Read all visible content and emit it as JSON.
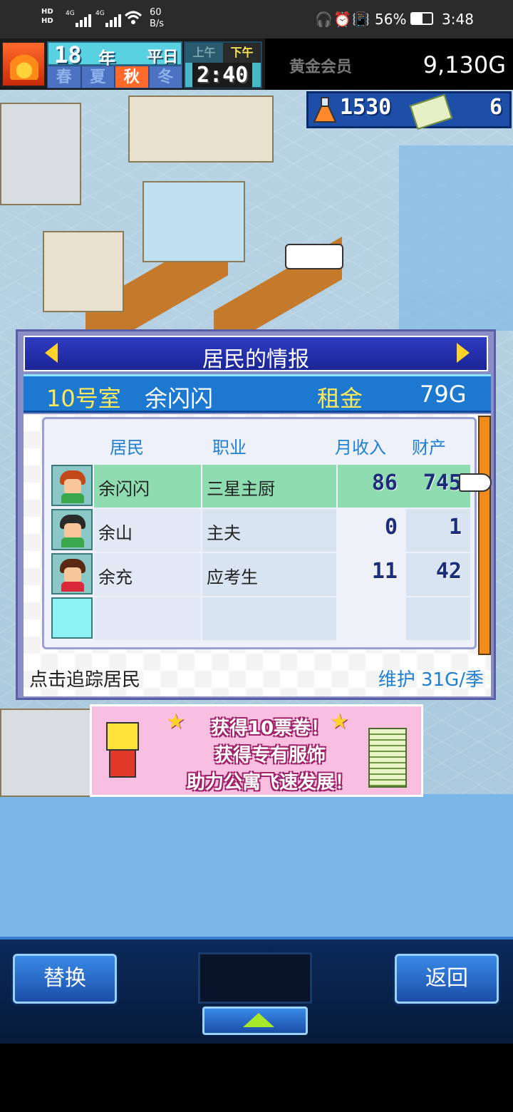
{
  "status_bar": {
    "net_top": "HD",
    "net_bottom": "HD",
    "sim1_type": "4G",
    "sim2_type": "4G",
    "speed_value": "60",
    "speed_unit": "B/s",
    "battery": "56%",
    "time": "3:48"
  },
  "hud": {
    "year_number": "18",
    "year_unit": "年",
    "weekday": "平日",
    "seasons": [
      "春",
      "夏",
      "秋",
      "冬"
    ],
    "active_season": "秋",
    "am_label": "上午",
    "pm_label": "下午",
    "active_period": "下午",
    "clock": "2:40",
    "membership_label": "黄金会员",
    "gold": "9,130G",
    "research_points": "1530",
    "tickets": "6"
  },
  "panel": {
    "title": "居民的情报",
    "room_number": "10号室",
    "room_resident": "余闪闪",
    "rent_label": "租金",
    "rent_value": "79G",
    "headers": {
      "resident": "居民",
      "job": "职业",
      "income": "月收入",
      "assets": "财产"
    },
    "rows": [
      {
        "name": "余闪闪",
        "job": "三星主厨",
        "income": "86",
        "assets": "745"
      },
      {
        "name": "余山",
        "job": "主夫",
        "income": "0",
        "assets": "1"
      },
      {
        "name": "余充",
        "job": "应考生",
        "income": "11",
        "assets": "42"
      }
    ],
    "track_hint": "点击追踪居民",
    "maintenance": "维护 31G/季"
  },
  "promo": {
    "line1": "获得10票卷！",
    "line2": "获得专有服饰",
    "line3": "助力公寓飞速发展！"
  },
  "bottom": {
    "replace_label": "替换",
    "back_label": "返回"
  },
  "colors": {
    "panel_title_bg": "#1b2596",
    "room_bar_bg": "#1d78d0",
    "highlight_row": "#8fdcb0",
    "header_text": "#1f7fd0",
    "accent_yellow": "#ffe95a"
  }
}
